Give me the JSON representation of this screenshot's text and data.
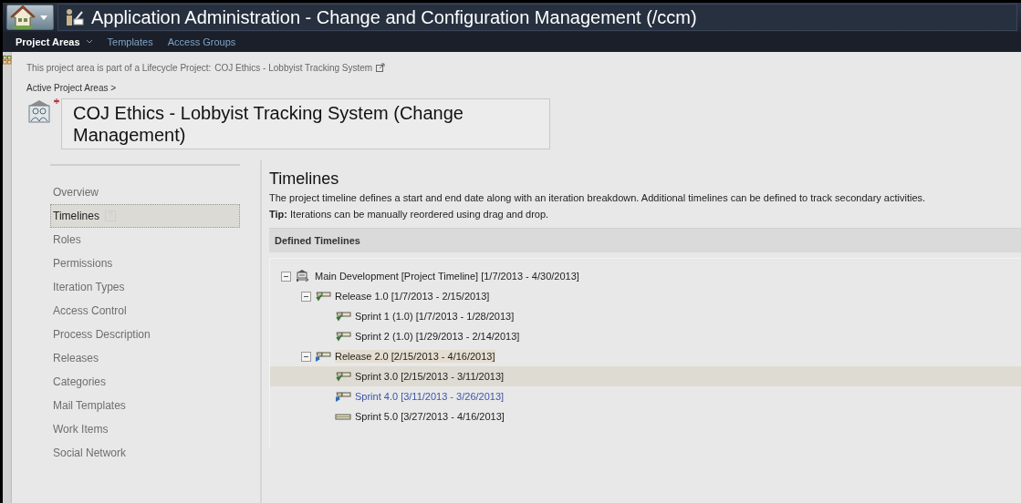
{
  "window": {
    "title": "Application Administration - Change and Configuration Management (/ccm)"
  },
  "nav": [
    {
      "label": "Project Areas",
      "selected": true,
      "dropdown": true
    },
    {
      "label": "Templates",
      "selected": false,
      "dropdown": false
    },
    {
      "label": "Access Groups",
      "selected": false,
      "dropdown": false
    }
  ],
  "lifecycle": {
    "text": "This project area is part of a Lifecycle Project:",
    "link": "COJ Ethics - Lobbyist Tracking System"
  },
  "breadcrumb": "Active Project Areas >",
  "project_name": "COJ Ethics - Lobbyist Tracking System (Change Management)",
  "sidebar": {
    "items": [
      {
        "label": "Overview",
        "selected": false
      },
      {
        "label": "Timelines",
        "selected": true
      },
      {
        "label": "Roles",
        "selected": false
      },
      {
        "label": "Permissions",
        "selected": false
      },
      {
        "label": "Iteration Types",
        "selected": false
      },
      {
        "label": "Access Control",
        "selected": false
      },
      {
        "label": "Process Description",
        "selected": false
      },
      {
        "label": "Releases",
        "selected": false
      },
      {
        "label": "Categories",
        "selected": false
      },
      {
        "label": "Mail Templates",
        "selected": false
      },
      {
        "label": "Work Items",
        "selected": false
      },
      {
        "label": "Social Network",
        "selected": false
      }
    ]
  },
  "section": {
    "title": "Timelines",
    "description": "The project timeline defines a start and end date along with an iteration breakdown. Additional timelines can be defined to track secondary activities.",
    "tip_label": "Tip:",
    "tip": "Iterations can be manually reordered using drag and drop."
  },
  "defined_timelines": {
    "title": "Defined Timelines",
    "tree": [
      {
        "label": "Main Development [Project Timeline] [1/7/2013 - 4/30/2013]",
        "kind": "timeline",
        "expanded": true,
        "selected": false,
        "highlighted": false,
        "current": false,
        "children": [
          {
            "label": "Release 1.0 [1/7/2013 - 2/15/2013]",
            "kind": "done",
            "expanded": true,
            "selected": false,
            "highlighted": false,
            "current": false,
            "children": [
              {
                "label": "Sprint 1 (1.0) [1/7/2013 - 1/28/2013]",
                "kind": "done",
                "selected": false,
                "highlighted": false,
                "current": false
              },
              {
                "label": "Sprint 2 (1.0) [1/29/2013 - 2/14/2013]",
                "kind": "done",
                "selected": false,
                "highlighted": false,
                "current": false
              }
            ]
          },
          {
            "label": "Release 2.0 [2/15/2013 - 4/16/2013]",
            "kind": "active",
            "expanded": true,
            "selected": false,
            "highlighted": true,
            "current": false,
            "children": [
              {
                "label": "Sprint 3.0 [2/15/2013 - 3/11/2013]",
                "kind": "done",
                "selected": true,
                "highlighted": false,
                "current": false
              },
              {
                "label": "Sprint 4.0 [3/11/2013 - 3/26/2013]",
                "kind": "active",
                "selected": false,
                "highlighted": false,
                "current": true
              },
              {
                "label": "Sprint 5.0 [3/27/2013 - 4/16/2013]",
                "kind": "future",
                "selected": false,
                "highlighted": false,
                "current": false
              }
            ]
          }
        ]
      }
    ]
  }
}
